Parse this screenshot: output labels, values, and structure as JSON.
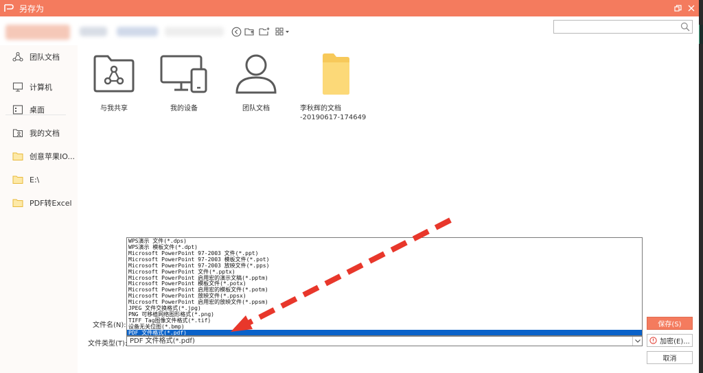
{
  "window": {
    "title": "另存为"
  },
  "toolbar": {
    "nav_icons": [
      "back-circle-icon",
      "folder-up-icon",
      "new-folder-icon",
      "view-grid-icon"
    ],
    "search": {
      "value": "",
      "placeholder": ""
    }
  },
  "sidebar": {
    "items": [
      {
        "label": "团队文档",
        "icon": "team-docs-icon"
      },
      {
        "label": "计算机",
        "icon": "computer-icon"
      },
      {
        "label": "桌面",
        "icon": "desktop-icon"
      },
      {
        "label": "我的文档",
        "icon": "my-documents-icon"
      },
      {
        "label": "创意苹果IO...",
        "icon": "folder-icon"
      },
      {
        "label": "E:\\",
        "icon": "folder-icon"
      },
      {
        "label": "PDF转Excel",
        "icon": "folder-icon"
      }
    ]
  },
  "content": {
    "files": [
      {
        "label": "与我共享",
        "icon": "shared-with-me-icon"
      },
      {
        "label": "我的设备",
        "icon": "my-devices-icon"
      },
      {
        "label": "团队文档",
        "icon": "team-documents-icon"
      },
      {
        "label": "李秋辉的文档\n-20190617-174649",
        "icon": "folder-icon"
      }
    ]
  },
  "form": {
    "filename_label": "文件名(N):",
    "filetype_label": "文件类型(T):",
    "filetype_selected": "PDF 文件格式(*.pdf)",
    "filetype_options": [
      "WPS演示 文件(*.dps)",
      "WPS演示 模板文件(*.dpt)",
      "Microsoft PowerPoint 97-2003 文件(*.ppt)",
      "Microsoft PowerPoint 97-2003 模板文件(*.pot)",
      "Microsoft PowerPoint 97-2003 放映文件(*.pps)",
      "Microsoft PowerPoint 文件(*.pptx)",
      "Microsoft PowerPoint 启用宏的演示文稿(*.pptm)",
      "Microsoft PowerPoint 模板文件(*.potx)",
      "Microsoft PowerPoint 启用宏的模板文件(*.potm)",
      "Microsoft PowerPoint 放映文件(*.ppsx)",
      "Microsoft PowerPoint 启用宏的放映文件(*.ppsm)",
      "JPEG 文件交换格式(*.jpg)",
      "PNG 可移植网络图形格式(*.png)",
      "TIFF Tag图像文件格式(*.tif)",
      "设备无关位图(*.bmp)",
      "PDF 文件格式(*.pdf)"
    ],
    "selected_index": 15
  },
  "buttons": {
    "save": "保存(S)",
    "encrypt": "加密(E)...",
    "cancel": "取消"
  },
  "colors": {
    "accent": "#f47b5e",
    "selection": "#0a62c9",
    "annotation_arrow": "#e8372b"
  }
}
